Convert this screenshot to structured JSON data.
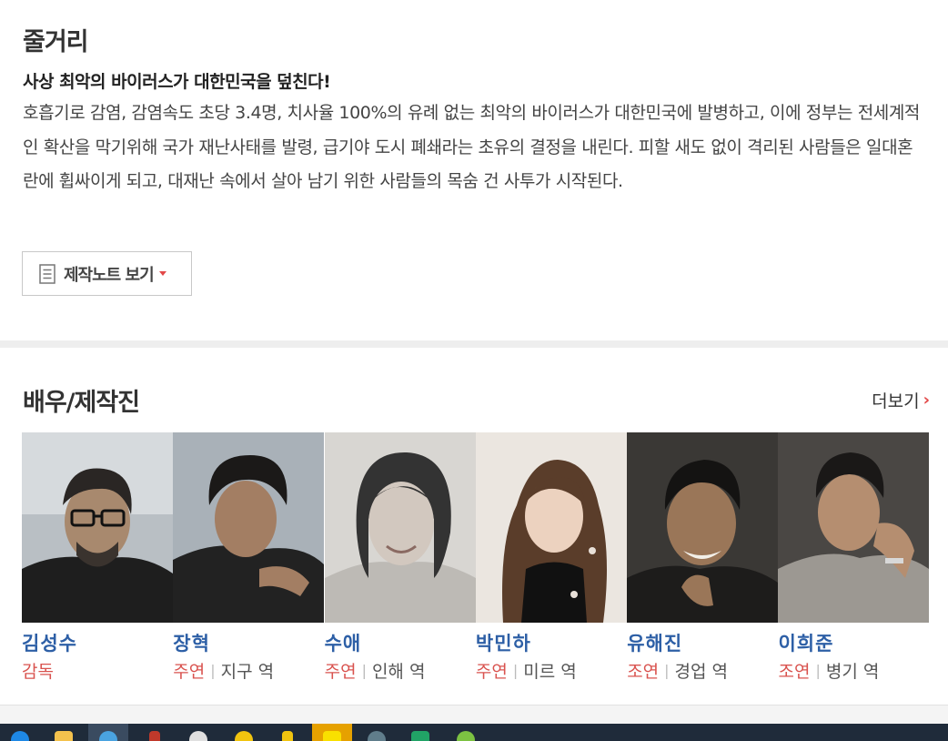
{
  "synopsis": {
    "title": "줄거리",
    "headline": "사상 최악의 바이러스가 대한민국을 덮친다!",
    "body": "호흡기로 감염, 감염속도 초당 3.4명, 치사율 100%의 유례 없는 최악의 바이러스가 대한민국에 발병하고, 이에 정부는 전세계적인 확산을 막기위해 국가 재난사태를 발령, 급기야 도시 폐쇄라는 초유의 결정을 내린다. 피할 새도 없이 격리된 사람들은 일대혼란에 휩싸이게 되고, 대재난 속에서 살아 남기 위한 사람들의 목숨 건 사투가 시작된다.",
    "note_button": {
      "label": "제작노트 보기",
      "icon": "document-icon"
    }
  },
  "cast": {
    "title": "배우/제작진",
    "more_label": "더보기",
    "more_icon": "chevron-right-icon",
    "members": [
      {
        "name": "김성수",
        "type": "감독",
        "character": ""
      },
      {
        "name": "장혁",
        "type": "주연",
        "character": "지구 역"
      },
      {
        "name": "수애",
        "type": "주연",
        "character": "인해 역"
      },
      {
        "name": "박민하",
        "type": "주연",
        "character": "미르 역"
      },
      {
        "name": "유해진",
        "type": "조연",
        "character": "경업 역"
      },
      {
        "name": "이희준",
        "type": "조연",
        "character": "병기 역"
      }
    ]
  },
  "taskbar": {
    "items": [
      {
        "icon": "windows-start-icon",
        "color": "#1e88e5"
      },
      {
        "icon": "folder-icon",
        "color": "#f4c24d"
      },
      {
        "icon": "internet-explorer-icon",
        "color": "#4aa3e0"
      },
      {
        "icon": "app-icon",
        "color": "#c0392b"
      },
      {
        "icon": "mascot-icon",
        "color": "#e0e0e0"
      },
      {
        "icon": "sun-icon",
        "color": "#f1c40f"
      },
      {
        "icon": "lock-icon",
        "color": "#f1c40f"
      },
      {
        "icon": "kakaotalk-icon",
        "color": "#f9e000"
      },
      {
        "icon": "back-icon",
        "color": "#607d8b"
      },
      {
        "icon": "excel-icon",
        "color": "#21a366"
      },
      {
        "icon": "refresh-icon",
        "color": "#7cc242"
      }
    ]
  },
  "colors": {
    "accent_red": "#d9534f",
    "name_blue": "#2d5fa6",
    "divider": "#eeeeee"
  }
}
